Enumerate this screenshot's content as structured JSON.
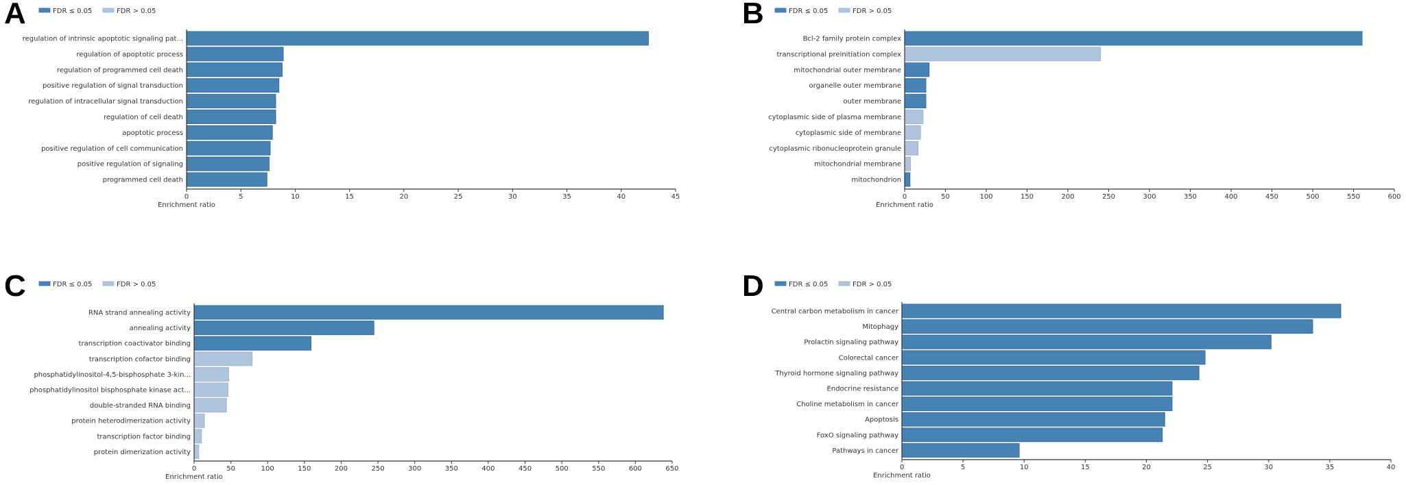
{
  "legend": {
    "sig_label": "FDR ≤ 0.05",
    "nonsig_label": "FDR > 0.05",
    "sig_color": "#4682b4",
    "sig_stroke": "#3a6f9e",
    "nonsig_color": "#b0c4de",
    "nonsig_stroke": "#9fb6d4"
  },
  "chart_data": [
    {
      "panel": "A",
      "type": "bar",
      "orientation": "horizontal",
      "xlabel": "Enrichment ratio",
      "xlim": [
        0,
        45
      ],
      "xticks": [
        0,
        5,
        10,
        15,
        20,
        25,
        30,
        35,
        40,
        45
      ],
      "legend_position": "top-left",
      "categories": [
        "regulation of intrinsic apoptotic signaling pat...",
        "regulation of apoptotic process",
        "regulation of programmed cell death",
        "positive regulation of signal transduction",
        "regulation of intracellular signal transduction",
        "regulation of cell death",
        "apoptotic process",
        "positive regulation of cell communication",
        "positive regulation of signaling",
        "programmed cell death"
      ],
      "values": [
        42.5,
        8.9,
        8.8,
        8.5,
        8.2,
        8.2,
        7.9,
        7.7,
        7.6,
        7.4
      ],
      "fdr_significant": [
        true,
        true,
        true,
        true,
        true,
        true,
        true,
        true,
        true,
        true
      ]
    },
    {
      "panel": "B",
      "type": "bar",
      "orientation": "horizontal",
      "xlabel": "Enrichment ratio",
      "xlim": [
        0,
        600
      ],
      "xticks": [
        0,
        50,
        100,
        150,
        200,
        250,
        300,
        350,
        400,
        450,
        500,
        550,
        600
      ],
      "legend_position": "top-left",
      "categories": [
        "Bcl-2 family protein complex",
        "transcriptional preinitiation complex",
        "mitochondrial outer membrane",
        "organelle outer membrane",
        "outer membrane",
        "cytoplasmic side of plasma membrane",
        "cytoplasmic side of membrane",
        "cytoplasmic ribonucleoprotein granule",
        "mitochondrial membrane",
        "mitochondrion"
      ],
      "values": [
        560.5,
        240,
        30,
        26,
        26,
        22.6,
        19.5,
        16.4,
        7.3,
        6.5
      ],
      "fdr_significant": [
        true,
        false,
        true,
        true,
        true,
        false,
        false,
        false,
        false,
        true
      ]
    },
    {
      "panel": "C",
      "type": "bar",
      "orientation": "horizontal",
      "xlabel": "Enrichment ratio",
      "xlim": [
        0,
        650
      ],
      "xticks": [
        0,
        50,
        100,
        150,
        200,
        250,
        300,
        350,
        400,
        450,
        500,
        550,
        600,
        650
      ],
      "legend_position": "top-left",
      "categories": [
        "RNA strand annealing activity",
        "annealing activity",
        "transcription coactivator binding",
        "transcription cofactor binding",
        "phosphatidylinositol-4,5-bisphosphate 3-kin...",
        "phosphatidylinositol bisphosphate kinase act...",
        "double-stranded RNA binding",
        "protein heterodimerization activity",
        "transcription factor binding",
        "protein dimerization activity"
      ],
      "values": [
        638,
        244.5,
        159,
        79,
        47,
        46,
        44,
        14,
        10,
        6.3
      ],
      "fdr_significant": [
        true,
        true,
        true,
        false,
        false,
        false,
        false,
        false,
        false,
        false
      ]
    },
    {
      "panel": "D",
      "type": "bar",
      "orientation": "horizontal",
      "xlabel": "Enrichment ratio",
      "xlim": [
        0,
        40
      ],
      "xticks": [
        0,
        5,
        10,
        15,
        20,
        25,
        30,
        35,
        40
      ],
      "legend_position": "top-left",
      "categories": [
        "Central carbon metabolism in cancer",
        "Mitophagy",
        "Prolactin signaling pathway",
        "Colorectal cancer",
        "Thyroid hormone signaling pathway",
        "Endocrine resistance",
        "Choline metabolism in cancer",
        "Apoptosis",
        "FoxO signaling pathway",
        "Pathways in cancer"
      ],
      "values": [
        35.9,
        33.6,
        30.2,
        24.8,
        24.3,
        22.1,
        22.1,
        21.5,
        21.3,
        9.6
      ],
      "fdr_significant": [
        true,
        true,
        true,
        true,
        true,
        true,
        true,
        true,
        true,
        true
      ]
    }
  ]
}
